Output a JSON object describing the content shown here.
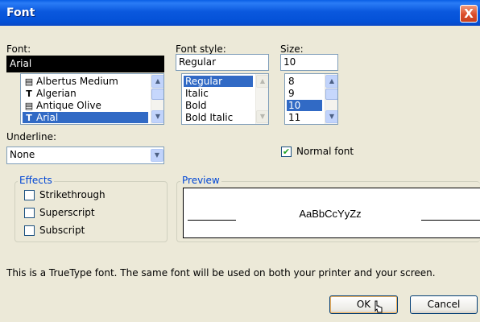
{
  "window": {
    "title": "Font",
    "close_glyph": "X"
  },
  "font": {
    "label": "Font:",
    "value": "Arial",
    "items": [
      {
        "name": "Albertus Medium",
        "icon": "printer-font-icon",
        "glyph": "▤"
      },
      {
        "name": "Algerian",
        "icon": "truetype-font-icon",
        "glyph": "T"
      },
      {
        "name": "Antique Olive",
        "icon": "printer-font-icon",
        "glyph": "▤"
      },
      {
        "name": "Arial",
        "icon": "truetype-font-icon",
        "glyph": "T"
      }
    ],
    "selected_index": 3
  },
  "style": {
    "label": "Font style:",
    "value": "Regular",
    "items": [
      "Regular",
      "Italic",
      "Bold",
      "Bold Italic"
    ],
    "selected_index": 0
  },
  "size": {
    "label": "Size:",
    "value": "10",
    "items": [
      "8",
      "9",
      "10",
      "11"
    ],
    "selected_index": 2
  },
  "underline": {
    "label": "Underline:",
    "value": "None"
  },
  "normal_font": {
    "label": "Normal font",
    "checked": true
  },
  "effects": {
    "label": "Effects",
    "strikethrough": "Strikethrough",
    "superscript": "Superscript",
    "subscript": "Subscript"
  },
  "preview": {
    "label": "Preview",
    "sample": "AaBbCcYyZz"
  },
  "info_text": "This is a TrueType font.  The same font will be used on both your printer and your screen.",
  "buttons": {
    "ok": "OK",
    "cancel": "Cancel"
  },
  "colors": {
    "title_bar": "#0a58de",
    "selection": "#316ac5",
    "group_label": "#0046d5"
  }
}
